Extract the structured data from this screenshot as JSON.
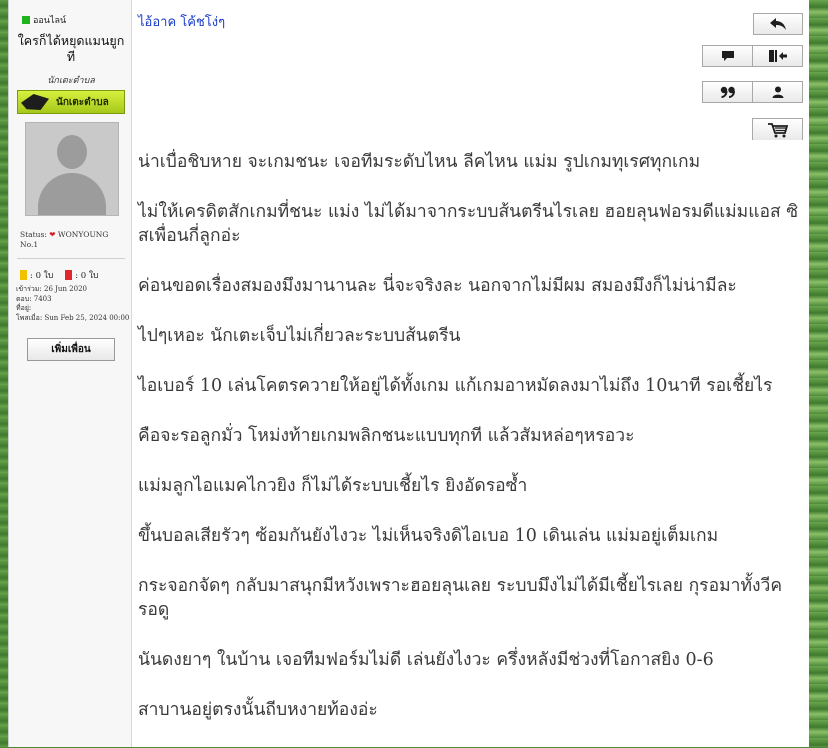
{
  "profile": {
    "online_label": "ออนไลน์",
    "username": "ใครก็ได้หยุดแมนยูก ที",
    "rank_title": "นักเตะตำบล",
    "rank_badge_label": "นักเตะตำบล",
    "status_prefix": "Status:",
    "status_text": "WONYOUNG No.1",
    "yellow_card_count": ": 0 ใบ",
    "red_card_count": ": 0 ใบ",
    "joined": "เข้าร่วม: 26 Jun 2020",
    "posts": "ตอบ: 7403",
    "location": "ที่อยู่:",
    "last_post": "โพสเมื่อ: Sun Feb 25, 2024 00:00",
    "add_friend_label": "เพิ่มเพื่อน"
  },
  "post": {
    "title": "ไอ้อาค โค้ชโง่ๆ",
    "paragraphs": [
      "น่าเบื่อชิบหาย จะเกมชนะ เจอทีมระดับไหน ลีคไหน แม่ม รูปเกมทุเรศทุกเกม",
      "ไม่ให้เครดิตสักเกมที่ชนะ แม่ง ไม่ได้มาจากระบบส้นตรีนไรเลย ฮอยลุนฟอรมดีแม่มแอส ซิสเพื่อนกี่ลูกอ่ะ",
      "ค่อนขอดเรื่องสมองมึงมานานละ นี่จะจริงละ นอกจากไม่มีผม สมองมึงก็ไม่น่ามีละ",
      "ไปๆเหอะ นักเตะเจ็บไม่เกี่ยวละระบบส้นตรีน",
      "ไอเบอร์ 10 เล่นโคตรควายให้อยู่ได้ทั้งเกม แก้เกมอาหมัดลงมาไม่ถึง 10นาที รอเชี้ยไร",
      "คือจะรอลูกมั่ว โหม่งท้ายเกมพลิกชนะแบบทุกที แล้วสัมหล่อๆหรอวะ",
      "แม่มลูกไอแมคไกวยิง ก็ไม่ได้ระบบเชี้ยไร ยิงอัดรอซ้ำ",
      "ขึ้นบอลเสียรัวๆ ซ้อมกันยังไงวะ ไม่เห็นจริงดิไอเบอ 10 เดินเล่น แม่มอยู่เต็มเกม",
      "กระจอกจัดๆ กลับมาสนุกมีหวังเพราะฮอยลุนเลย ระบบมึงไม่ได้มีเชี้ยไรเลย กุรอมาทั้งวีค รอดู",
      "นันดงยาๆ ในบ้าน เจอทีมฟอร์มไม่ดี เล่นยังไงวะ ครึ่งหลังมีช่วงที่โอกาสยิง 0-6",
      "สาบานอยู่ตรงนั้นถีบหงายท้องอ่ะ"
    ]
  },
  "colors": {
    "title_link": "#1a3cc8",
    "online_dot": "#1fb31f",
    "rank_badge": "#c5e02a",
    "background_grass": "#4e8a3a"
  },
  "icons": [
    "back-arrow-icon",
    "comment-icon",
    "exit-icon",
    "quote-icon",
    "user-icon",
    "cart-icon",
    "heart-icon",
    "boot-icon"
  ]
}
